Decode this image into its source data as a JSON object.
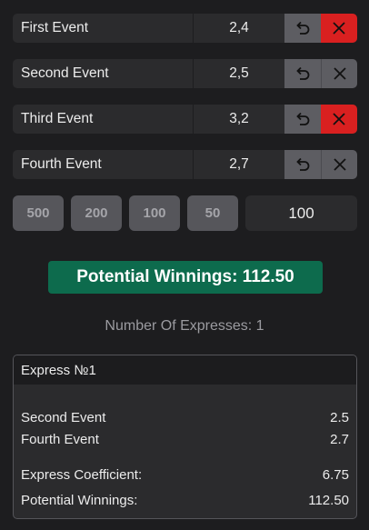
{
  "events": [
    {
      "name": "First Event",
      "coef": "2,4",
      "remove_active": true
    },
    {
      "name": "Second Event",
      "coef": "2,5",
      "remove_active": false
    },
    {
      "name": "Third Event",
      "coef": "3,2",
      "remove_active": true
    },
    {
      "name": "Fourth Event",
      "coef": "2,7",
      "remove_active": false
    }
  ],
  "icons": {
    "undo": "undo-icon",
    "remove": "close-icon"
  },
  "stake_buttons": [
    "500",
    "200",
    "100",
    "50"
  ],
  "stake_value": "100",
  "potential_winnings": "Potential Winnings: 112.50",
  "number_of_expresses": "Number Of Expresses: 1",
  "express": {
    "title": "Express №1",
    "events": [
      {
        "name": "Second Event",
        "coef": "2.5"
      },
      {
        "name": "Fourth Event",
        "coef": "2.7"
      }
    ],
    "coefficient_label": "Express Coefficient:",
    "coefficient_value": "6.75",
    "winnings_label": "Potential Winnings:",
    "winnings_value": "112.50"
  },
  "colors": {
    "background": "#1d1d1f",
    "row": "#2b2b2d",
    "remove_active": "#d92020",
    "button_gray": "#5d5d62",
    "potential_bg": "#0d6b4d"
  }
}
